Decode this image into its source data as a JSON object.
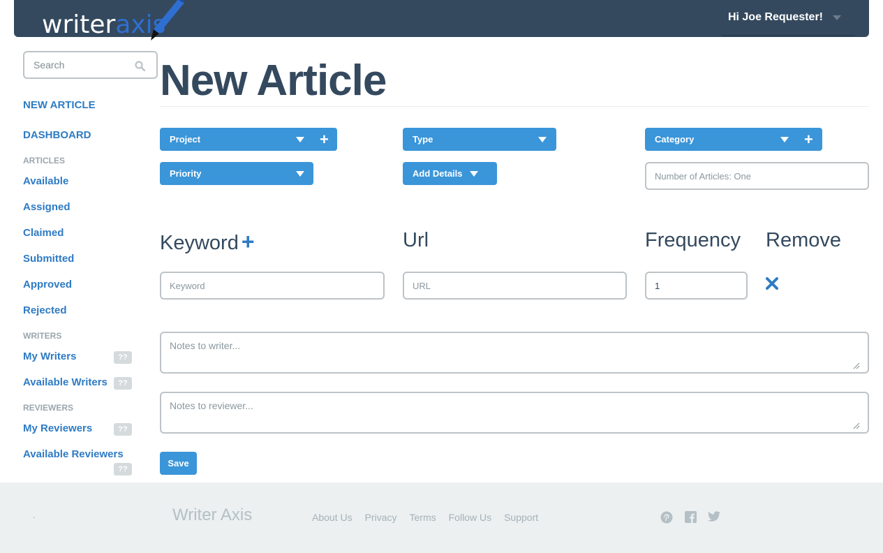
{
  "header": {
    "logo_text_a": "writer",
    "logo_text_b": "axis",
    "greeting": "Hi Joe Requester!"
  },
  "sidebar": {
    "search_placeholder": "Search",
    "new_article": "NEW ARTICLE",
    "dashboard": "DASHBOARD",
    "articles_heading": "ARTICLES",
    "articles": [
      "Available",
      "Assigned",
      "Claimed",
      "Submitted",
      "Approved",
      "Rejected"
    ],
    "writers_heading": "WRITERS",
    "my_writers": "My Writers",
    "available_writers": "Available Writers",
    "reviewers_heading": "REVIEWERS",
    "my_reviewers": "My Reviewers",
    "available_reviewers": "Available Reviewers",
    "badge": "??"
  },
  "main": {
    "title": "New Article",
    "project": "Project",
    "type": "Type",
    "category": "Category",
    "priority": "Priority",
    "add_details": "Add Details",
    "num_articles_placeholder": "Number of Articles: One",
    "col_keyword": "Keyword",
    "col_url": "Url",
    "col_frequency": "Frequency",
    "col_remove": "Remove",
    "keyword_placeholder": "Keyword",
    "url_placeholder": "URL",
    "frequency_value": "1",
    "notes_writer_placeholder": "Notes to writer...",
    "notes_reviewer_placeholder": "Notes to reviewer...",
    "save": "Save"
  },
  "footer": {
    "dot": ".",
    "brand": "Writer Axis",
    "links": [
      "About Us",
      "Privacy",
      "Terms",
      "Follow Us",
      "Support"
    ],
    "social_icons": [
      "pinterest-icon",
      "facebook-icon",
      "twitter-icon"
    ]
  },
  "colors": {
    "header_bg": "#34495e",
    "accent": "#3a95d9",
    "link": "#2e7bc4",
    "footer_bg": "#ecf0f1"
  }
}
